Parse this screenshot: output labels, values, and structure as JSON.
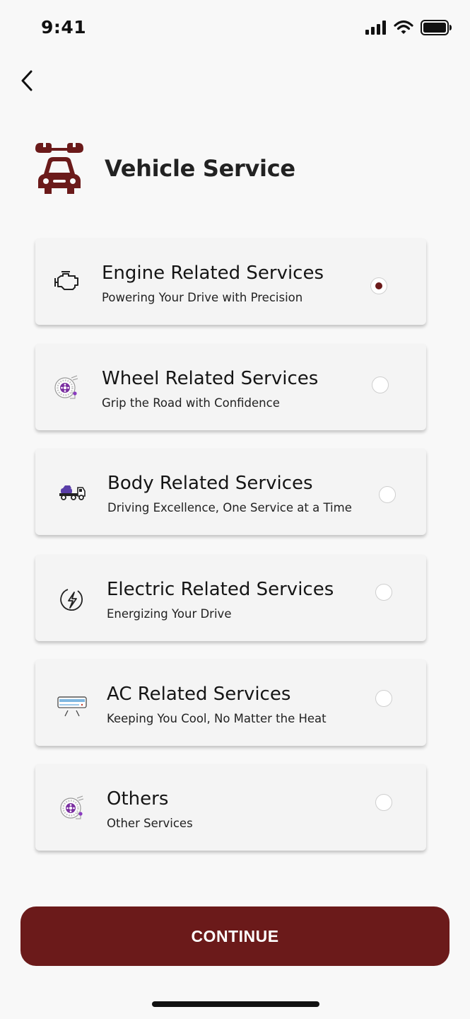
{
  "status_bar": {
    "time": "9:41"
  },
  "header": {
    "title": "Vehicle Service",
    "icon": "car-wrench-icon"
  },
  "services": [
    {
      "title": "Engine Related Services",
      "subtitle": "Powering Your Drive with Precision",
      "icon": "engine-icon",
      "selected": true
    },
    {
      "title": "Wheel Related Services",
      "subtitle": "Grip the Road with Confidence",
      "icon": "wheel-icon",
      "selected": false
    },
    {
      "title": "Body Related Services",
      "subtitle": "Driving Excellence, One Service at a Time",
      "icon": "tow-truck-icon",
      "selected": false
    },
    {
      "title": "Electric Related Services",
      "subtitle": "Energizing Your Drive",
      "icon": "lightning-icon",
      "selected": false
    },
    {
      "title": "AC Related Services",
      "subtitle": "Keeping You Cool, No Matter the Heat",
      "icon": "air-conditioner-icon",
      "selected": false
    },
    {
      "title": "Others",
      "subtitle": "Other Services",
      "icon": "wheel-icon",
      "selected": false
    }
  ],
  "continue_label": "CONTINUE",
  "colors": {
    "accent": "#6b1a1a",
    "background": "#f8f8f8",
    "card": "#f4f4f4"
  }
}
